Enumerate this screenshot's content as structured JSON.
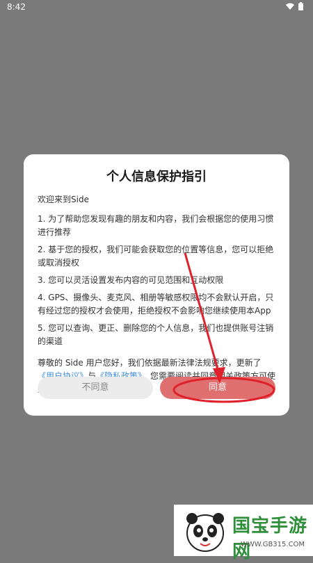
{
  "status_bar": {
    "time": "8:42"
  },
  "dialog": {
    "title": "个人信息保护指引",
    "welcome": "欢迎来到Side",
    "items": [
      "1. 为了帮助您发现有趣的朋友和内容，我们会根据您的使用习惯进行推荐",
      "2. 基于您的授权，我们可能会获取您的位置等信息，您可以拒绝或取消授权",
      "3. 您可以灵活设置发布内容的可见范围和互动权限",
      "4. GPS、摄像头、麦克风、相册等敏感权限均不会默认开启，只有经过您的授权才会使用，拒绝授权不会影响您继续使用本App",
      "5. 您可以查询、更正、删除您的个人信息，我们也提供账号注销的渠道"
    ],
    "notice_pre": "尊敬的 Side 用户您好，我们依据最新法律法规要求，更新了",
    "link_user_agreement": "《用户协议》",
    "notice_and": "与",
    "link_privacy_policy": "《隐私政策》",
    "notice_post": "。您需要阅读并同意相关政策方可使用。",
    "disagree_label": "不同意",
    "agree_label": "同意"
  },
  "watermark": {
    "brand": "国宝手游网",
    "url": "WWW.GB315.COM"
  },
  "colors": {
    "link": "#3d8de0",
    "agree_button": "#e07070",
    "annotation": "#e0202a"
  }
}
